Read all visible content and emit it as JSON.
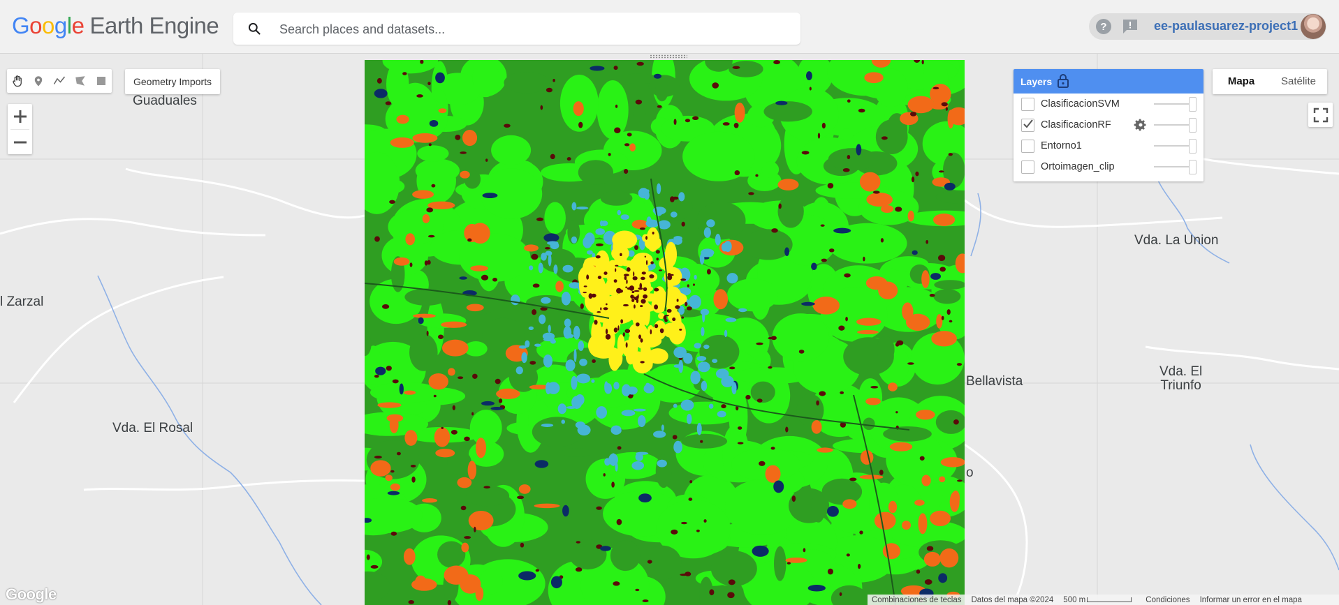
{
  "header": {
    "logo_google": [
      "G",
      "o",
      "o",
      "g",
      "l",
      "e"
    ],
    "logo_product": "Earth Engine",
    "search": {
      "placeholder": "Search places and datasets...",
      "value": ""
    },
    "help_icon": "help-circle-icon",
    "feedback_icon": "feedback-icon",
    "user": "ee-paulasuarez-project1"
  },
  "colors": {
    "google_blue": "#4285f4",
    "google_red": "#ea4335",
    "google_yellow": "#fbbc05",
    "google_green": "#34a853",
    "layers_header": "#4f8ff0",
    "class_dark_green": "#2f9e22",
    "class_light_green": "#29f215",
    "class_orange": "#f26a18",
    "class_yellow": "#fff01a",
    "class_cyan": "#46b5d6",
    "class_maroon": "#5a0a0a",
    "class_navy": "#0b2b66"
  },
  "tools": {
    "items": [
      "hand-icon",
      "marker-icon",
      "line-icon",
      "polygon-icon",
      "rectangle-icon"
    ],
    "geometry_imports": "Geometry Imports"
  },
  "zoom": {
    "in": "+",
    "out": "−"
  },
  "layers": {
    "title": "Layers",
    "items": [
      {
        "name": "ClasificacionSVM",
        "checked": false,
        "opacity": 1.0
      },
      {
        "name": "ClasificacionRF",
        "checked": true,
        "opacity": 1.0
      },
      {
        "name": "Entorno1",
        "checked": false,
        "opacity": 1.0
      },
      {
        "name": "Ortoimagen_clip",
        "checked": false,
        "opacity": 1.0
      }
    ]
  },
  "map_type": {
    "map": "Mapa",
    "satellite": "Satélite",
    "selected": "Mapa"
  },
  "map_labels": {
    "los_guaduales": "Vda. Los\nGuaduales",
    "el_zarzal": "l Zarzal",
    "el_rosal": "Vda. El Rosal",
    "la_union": "Vda. La Union",
    "bellavista": "Bellavista",
    "el_triunfo": "Vda. El\nTriunfo",
    "partial_o": "o"
  },
  "attribution": {
    "google": "Google",
    "keyboard": "Combinaciones de teclas",
    "map_data": "Datos del mapa ©2024",
    "scale": "500 m",
    "terms": "Condiciones",
    "report": "Informar un error en el mapa"
  }
}
